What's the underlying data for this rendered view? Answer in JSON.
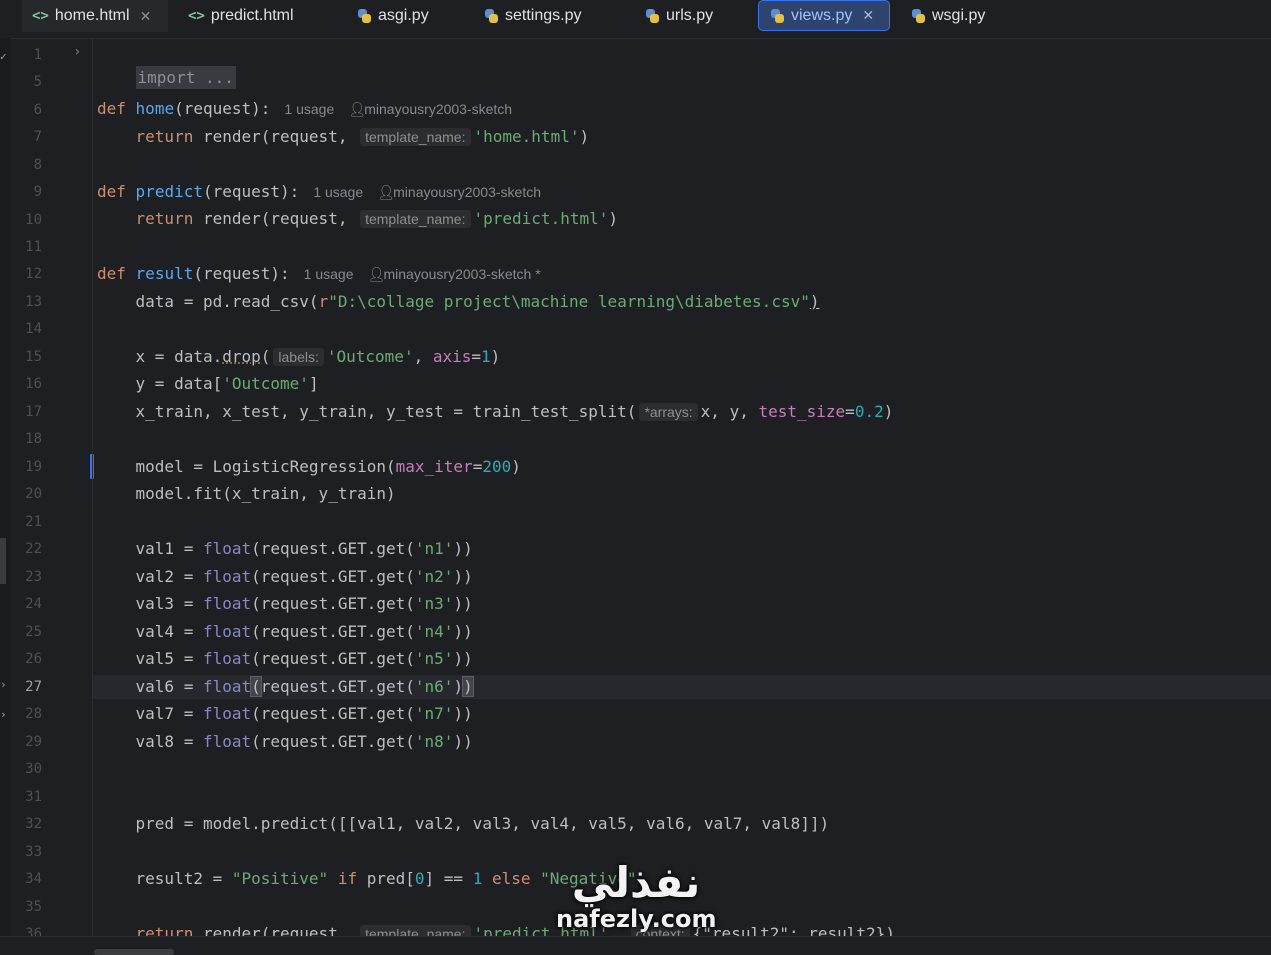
{
  "tabs": [
    {
      "label": "home.html",
      "icon": "html-file-icon",
      "closable": true
    },
    {
      "label": "predict.html",
      "icon": "html-file-icon",
      "closable": false
    },
    {
      "label": "asgi.py",
      "icon": "python-file-icon",
      "closable": false
    },
    {
      "label": "settings.py",
      "icon": "python-file-icon",
      "closable": false
    },
    {
      "label": "urls.py",
      "icon": "python-file-icon",
      "closable": false
    },
    {
      "label": "views.py",
      "icon": "python-file-icon",
      "closable": true,
      "active": true
    },
    {
      "label": "wsgi.py",
      "icon": "python-file-icon",
      "closable": false
    }
  ],
  "gutter": {
    "line_numbers": [
      "1",
      "5",
      "6",
      "7",
      "8",
      "9",
      "10",
      "11",
      "12",
      "13",
      "14",
      "15",
      "16",
      "17",
      "18",
      "19",
      "20",
      "21",
      "22",
      "23",
      "24",
      "25",
      "26",
      "27",
      "28",
      "29",
      "30",
      "31",
      "32",
      "33",
      "34",
      "35",
      "36"
    ],
    "current_line": "27"
  },
  "code": {
    "l1": {
      "fold_text": "import ..."
    },
    "l6": {
      "kw": "def",
      "name": "home",
      "rest": "(request):",
      "usage": "1 usage",
      "author": "minayousry2003-sketch"
    },
    "l7": {
      "pre": "    ",
      "kw": "return",
      "mid": " render(request, ",
      "hint": "template_name:",
      "str": "'home.html'",
      "post": ")"
    },
    "l9": {
      "kw": "def",
      "name": "predict",
      "rest": "(request):",
      "usage": "1 usage",
      "author": "minayousry2003-sketch"
    },
    "l10": {
      "pre": "    ",
      "kw": "return",
      "mid": " render(request, ",
      "hint": "template_name:",
      "str": "'predict.html'",
      "post": ")"
    },
    "l12": {
      "kw": "def",
      "name": "result",
      "rest": "(request):",
      "usage": "1 usage",
      "author": "minayousry2003-sketch *"
    },
    "l13": {
      "pre": "    data = pd.read_csv(",
      "prefix": "r",
      "str": "\"D:\\collage project\\machine learning\\diabetes.csv\"",
      "post": ")"
    },
    "l15": {
      "pre": "    x = data.",
      "method": "drop",
      "open": "(",
      "hint": "labels:",
      "str": "'Outcome'",
      "comma": ", ",
      "param": "axis",
      "eq": "=",
      "num": "1",
      "post": ")"
    },
    "l16": {
      "pre": "    y = data[",
      "str": "'Outcome'",
      "post": "]"
    },
    "l17": {
      "pre": "    x_train, x_test, y_train, y_test = train_test_split(",
      "hint": "*arrays:",
      "mid": "x, y, ",
      "param": "test_size",
      "eq": "=",
      "num": "0.2",
      "post": ")"
    },
    "l19": {
      "pre": "    model = LogisticRegression(",
      "param": "max_iter",
      "eq": "=",
      "num": "200",
      "post": ")"
    },
    "l20": {
      "text": "    model.fit(x_train, y_train)"
    },
    "val_lines": [
      {
        "var": "val1",
        "key": "'n1'"
      },
      {
        "var": "val2",
        "key": "'n2'"
      },
      {
        "var": "val3",
        "key": "'n3'"
      },
      {
        "var": "val4",
        "key": "'n4'"
      },
      {
        "var": "val5",
        "key": "'n5'"
      },
      {
        "var": "val6",
        "key": "'n6'"
      },
      {
        "var": "val7",
        "key": "'n7'"
      },
      {
        "var": "val8",
        "key": "'n8'"
      }
    ],
    "val_parts": {
      "eq": " = ",
      "builtin": "float",
      "call": "(request.GET.get(",
      "close": "))"
    },
    "l32": {
      "text": "    pred = model.predict([[val1, val2, val3, val4, val5, val6, val7, val8]])"
    },
    "l34": {
      "pre": "    result2 = ",
      "str1": "\"Positive\"",
      "kw1": " if ",
      "mid": "pred[",
      "num0": "0",
      "mid2": "] == ",
      "num1": "1",
      "kw2": " else ",
      "str2": "\"Negative\""
    },
    "l36": {
      "pre": "    ",
      "kw": "return",
      "mid": " render(request, ",
      "hint": "template_name:",
      "str": "'predict.html'",
      "comma": ", ",
      "hint2": "context:",
      "post": "{\"result2\": result2})"
    }
  },
  "watermark": {
    "arabic": "نفذلي",
    "latin": "nafezly.com"
  },
  "colors": {
    "background": "#1e1f22",
    "keyword": "#cf8e6d",
    "function": "#56a8f5",
    "string": "#6aab73",
    "number": "#2aacb8",
    "param": "#c77dba",
    "builtin": "#8888c6",
    "accent": "#3574f0"
  }
}
